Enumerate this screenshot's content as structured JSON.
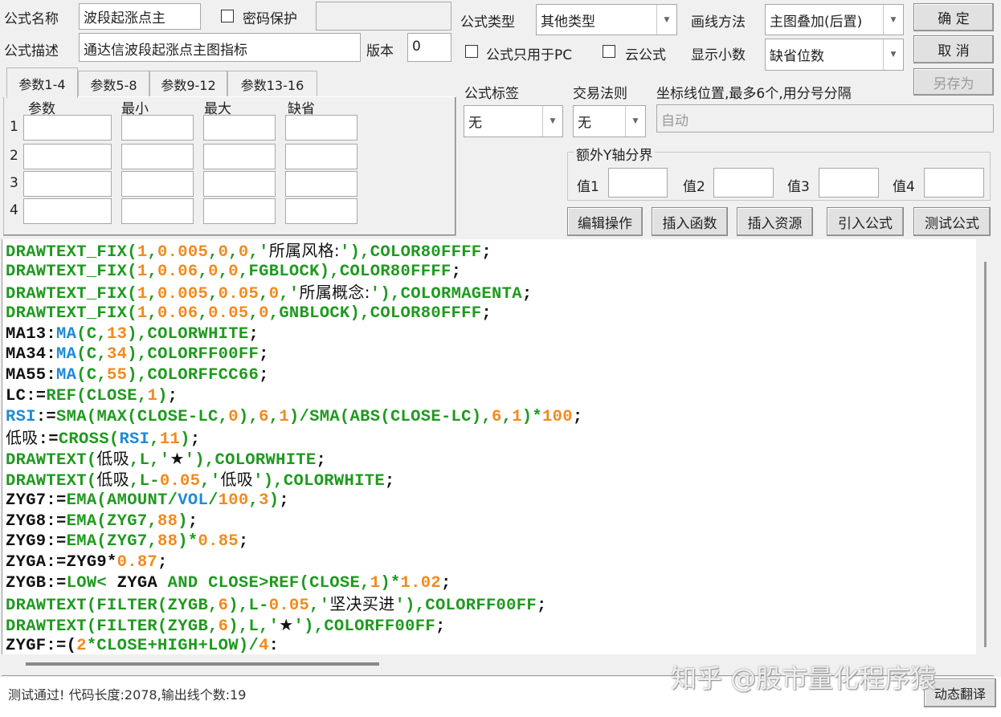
{
  "form": {
    "name_label": "公式名称",
    "name_value": "波段起涨点主",
    "password_label": "密码保护",
    "password_checked": false,
    "desc_label": "公式描述",
    "desc_value": "通达信波段起涨点主图指标",
    "version_label": "版本",
    "version_value": "0"
  },
  "param_tabs": [
    "参数1-4",
    "参数5-8",
    "参数9-12",
    "参数13-16"
  ],
  "param_headers": [
    "参数",
    "最小",
    "最大",
    "缺省"
  ],
  "param_rows": [
    "1",
    "2",
    "3",
    "4"
  ],
  "right": {
    "type_label": "公式类型",
    "type_value": "其他类型",
    "draw_label": "画线方法",
    "draw_value": "主图叠加(后置)",
    "pc_only_label": "公式只用于PC",
    "cloud_label": "云公式",
    "decimals_label": "显示小数",
    "decimals_value": "缺省位数",
    "tag_label": "公式标签",
    "tag_value": "无",
    "rule_label": "交易法则",
    "rule_value": "无",
    "coord_label": "坐标线位置,最多6个,用分号分隔",
    "coord_value": "自动",
    "yaxis_group": "额外Y轴分界",
    "yaxis_labels": [
      "值1",
      "值2",
      "值3",
      "值4"
    ]
  },
  "buttons": {
    "ok": "确  定",
    "cancel": "取  消",
    "save_as": "另存为",
    "edit_ops": "编辑操作",
    "insert_func": "插入函数",
    "insert_res": "插入资源",
    "import_formula": "引入公式",
    "test_formula": "测试公式",
    "dynamic_translate": "动态翻译"
  },
  "code_lines": [
    [
      [
        "g",
        "DRAWTEXT_FIX("
      ],
      [
        "o",
        "1"
      ],
      [
        "g",
        ","
      ],
      [
        "o",
        "0.005"
      ],
      [
        "g",
        ","
      ],
      [
        "o",
        "0"
      ],
      [
        "g",
        ","
      ],
      [
        "o",
        "0"
      ],
      [
        "g",
        ",'"
      ],
      [
        "kc",
        "所属风格:"
      ],
      [
        "g",
        "'),COLOR80FFFF"
      ],
      [
        "k",
        ";"
      ]
    ],
    [
      [
        "g",
        "DRAWTEXT_FIX("
      ],
      [
        "o",
        "1"
      ],
      [
        "g",
        ","
      ],
      [
        "o",
        "0.06"
      ],
      [
        "g",
        ","
      ],
      [
        "o",
        "0"
      ],
      [
        "g",
        ","
      ],
      [
        "o",
        "0"
      ],
      [
        "g",
        ",FGBLOCK),COLOR80FFFF"
      ],
      [
        "k",
        ";"
      ]
    ],
    [
      [
        "g",
        "DRAWTEXT_FIX("
      ],
      [
        "o",
        "1"
      ],
      [
        "g",
        ","
      ],
      [
        "o",
        "0.005"
      ],
      [
        "g",
        ","
      ],
      [
        "o",
        "0.05"
      ],
      [
        "g",
        ","
      ],
      [
        "o",
        "0"
      ],
      [
        "g",
        ",'"
      ],
      [
        "kc",
        "所属概念:"
      ],
      [
        "g",
        "'),COLORMAGENTA"
      ],
      [
        "k",
        ";"
      ]
    ],
    [
      [
        "g",
        "DRAWTEXT_FIX("
      ],
      [
        "o",
        "1"
      ],
      [
        "g",
        ","
      ],
      [
        "o",
        "0.06"
      ],
      [
        "g",
        ","
      ],
      [
        "o",
        "0.05"
      ],
      [
        "g",
        ","
      ],
      [
        "o",
        "0"
      ],
      [
        "g",
        ",GNBLOCK),COLOR80FFFF"
      ],
      [
        "k",
        ";"
      ]
    ],
    [
      [
        "k",
        "MA13:"
      ],
      [
        "b",
        "MA"
      ],
      [
        "g",
        "(C,"
      ],
      [
        "o",
        "13"
      ],
      [
        "g",
        "),COLORWHITE"
      ],
      [
        "k",
        ";"
      ]
    ],
    [
      [
        "k",
        "MA34:"
      ],
      [
        "b",
        "MA"
      ],
      [
        "g",
        "(C,"
      ],
      [
        "o",
        "34"
      ],
      [
        "g",
        "),COLORFF00FF"
      ],
      [
        "k",
        ";"
      ]
    ],
    [
      [
        "k",
        "MA55:"
      ],
      [
        "b",
        "MA"
      ],
      [
        "g",
        "(C,"
      ],
      [
        "o",
        "55"
      ],
      [
        "g",
        "),COLORFFCC66"
      ],
      [
        "k",
        ";"
      ]
    ],
    [
      [
        "k",
        "LC:="
      ],
      [
        "g",
        "REF(CLOSE,"
      ],
      [
        "o",
        "1"
      ],
      [
        "g",
        ")"
      ],
      [
        "k",
        ";"
      ]
    ],
    [
      [
        "b",
        "RSI"
      ],
      [
        "k",
        ":="
      ],
      [
        "g",
        "SMA(MAX(CLOSE-LC,"
      ],
      [
        "o",
        "0"
      ],
      [
        "g",
        "),"
      ],
      [
        "o",
        "6"
      ],
      [
        "g",
        ","
      ],
      [
        "o",
        "1"
      ],
      [
        "g",
        ")/SMA(ABS(CLOSE-LC),"
      ],
      [
        "o",
        "6"
      ],
      [
        "g",
        ","
      ],
      [
        "o",
        "1"
      ],
      [
        "g",
        ")*"
      ],
      [
        "o",
        "100"
      ],
      [
        "k",
        ";"
      ]
    ],
    [
      [
        "kc",
        "低吸"
      ],
      [
        "k",
        ":="
      ],
      [
        "g",
        "CROSS("
      ],
      [
        "b",
        "RSI"
      ],
      [
        "g",
        ","
      ],
      [
        "o",
        "11"
      ],
      [
        "g",
        ")"
      ],
      [
        "k",
        ";"
      ]
    ],
    [
      [
        "g",
        "DRAWTEXT("
      ],
      [
        "kc",
        "低吸"
      ],
      [
        "g",
        ",L,'"
      ],
      [
        "kc",
        "★"
      ],
      [
        "g",
        "'),COLORWHITE"
      ],
      [
        "k",
        ";"
      ]
    ],
    [
      [
        "g",
        "DRAWTEXT("
      ],
      [
        "kc",
        "低吸"
      ],
      [
        "g",
        ",L-"
      ],
      [
        "o",
        "0.05"
      ],
      [
        "g",
        ",'"
      ],
      [
        "kc",
        "低吸"
      ],
      [
        "g",
        "'),COLORWHITE"
      ],
      [
        "k",
        ";"
      ]
    ],
    [
      [
        "k",
        "ZYG7:="
      ],
      [
        "g",
        "EMA(AMOUNT/"
      ],
      [
        "b",
        "VOL"
      ],
      [
        "g",
        "/"
      ],
      [
        "o",
        "100"
      ],
      [
        "g",
        ","
      ],
      [
        "o",
        "3"
      ],
      [
        "g",
        ")"
      ],
      [
        "k",
        ";"
      ]
    ],
    [
      [
        "k",
        "ZYG8:="
      ],
      [
        "g",
        "EMA(ZYG7,"
      ],
      [
        "o",
        "88"
      ],
      [
        "g",
        ")"
      ],
      [
        "k",
        ";"
      ]
    ],
    [
      [
        "k",
        "ZYG9:="
      ],
      [
        "g",
        "EMA(ZYG7,"
      ],
      [
        "o",
        "88"
      ],
      [
        "g",
        ")*"
      ],
      [
        "o",
        "0.85"
      ],
      [
        "k",
        ";"
      ]
    ],
    [
      [
        "k",
        "ZYGA:=ZYG9*"
      ],
      [
        "o",
        "0.87"
      ],
      [
        "k",
        ";"
      ]
    ],
    [
      [
        "k",
        "ZYGB:="
      ],
      [
        "g",
        "LOW< "
      ],
      [
        "k",
        "ZYGA "
      ],
      [
        "g",
        "AND CLOSE>REF(CLOSE,"
      ],
      [
        "o",
        "1"
      ],
      [
        "g",
        ")*"
      ],
      [
        "o",
        "1.02"
      ],
      [
        "k",
        ";"
      ]
    ],
    [
      [
        "g",
        "DRAWTEXT(FILTER(ZYGB,"
      ],
      [
        "o",
        "6"
      ],
      [
        "g",
        "),L-"
      ],
      [
        "o",
        "0.05"
      ],
      [
        "g",
        ",'"
      ],
      [
        "kc",
        "坚决买进"
      ],
      [
        "g",
        "'),COLORFF00FF"
      ],
      [
        "k",
        ";"
      ]
    ],
    [
      [
        "g",
        "DRAWTEXT(FILTER(ZYGB,"
      ],
      [
        "o",
        "6"
      ],
      [
        "g",
        "),L,'"
      ],
      [
        "kc",
        "★"
      ],
      [
        "g",
        "'),COLORFF00FF"
      ],
      [
        "k",
        ";"
      ]
    ],
    [
      [
        "k",
        "ZYGF:=("
      ],
      [
        "o",
        "2"
      ],
      [
        "g",
        "*CLOSE+HIGH+LOW)/"
      ],
      [
        "o",
        "4"
      ],
      [
        "k",
        ":"
      ]
    ]
  ],
  "status": "测试通过! 代码长度:2078,输出线个数:19",
  "watermark": "知乎 @股市量化程序猿"
}
